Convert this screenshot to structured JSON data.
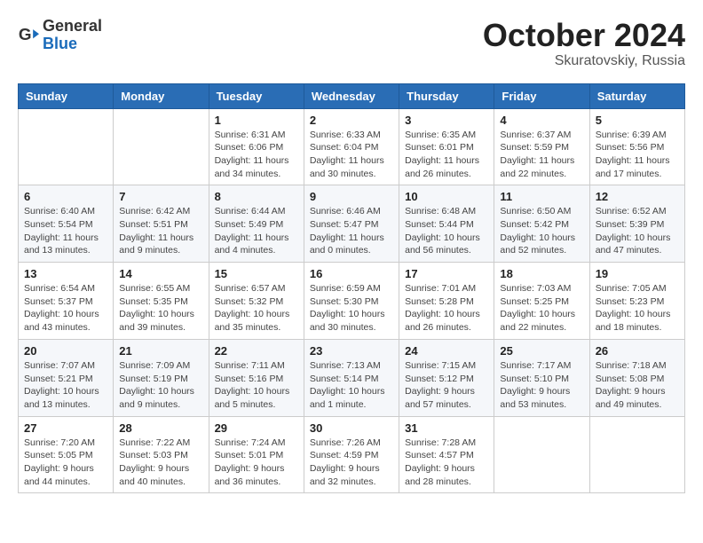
{
  "logo": {
    "text_general": "General",
    "text_blue": "Blue"
  },
  "title": {
    "month": "October 2024",
    "location": "Skuratovskiy, Russia"
  },
  "header_days": [
    "Sunday",
    "Monday",
    "Tuesday",
    "Wednesday",
    "Thursday",
    "Friday",
    "Saturday"
  ],
  "weeks": [
    [
      {
        "day": "",
        "info": ""
      },
      {
        "day": "",
        "info": ""
      },
      {
        "day": "1",
        "info": "Sunrise: 6:31 AM\nSunset: 6:06 PM\nDaylight: 11 hours and 34 minutes."
      },
      {
        "day": "2",
        "info": "Sunrise: 6:33 AM\nSunset: 6:04 PM\nDaylight: 11 hours and 30 minutes."
      },
      {
        "day": "3",
        "info": "Sunrise: 6:35 AM\nSunset: 6:01 PM\nDaylight: 11 hours and 26 minutes."
      },
      {
        "day": "4",
        "info": "Sunrise: 6:37 AM\nSunset: 5:59 PM\nDaylight: 11 hours and 22 minutes."
      },
      {
        "day": "5",
        "info": "Sunrise: 6:39 AM\nSunset: 5:56 PM\nDaylight: 11 hours and 17 minutes."
      }
    ],
    [
      {
        "day": "6",
        "info": "Sunrise: 6:40 AM\nSunset: 5:54 PM\nDaylight: 11 hours and 13 minutes."
      },
      {
        "day": "7",
        "info": "Sunrise: 6:42 AM\nSunset: 5:51 PM\nDaylight: 11 hours and 9 minutes."
      },
      {
        "day": "8",
        "info": "Sunrise: 6:44 AM\nSunset: 5:49 PM\nDaylight: 11 hours and 4 minutes."
      },
      {
        "day": "9",
        "info": "Sunrise: 6:46 AM\nSunset: 5:47 PM\nDaylight: 11 hours and 0 minutes."
      },
      {
        "day": "10",
        "info": "Sunrise: 6:48 AM\nSunset: 5:44 PM\nDaylight: 10 hours and 56 minutes."
      },
      {
        "day": "11",
        "info": "Sunrise: 6:50 AM\nSunset: 5:42 PM\nDaylight: 10 hours and 52 minutes."
      },
      {
        "day": "12",
        "info": "Sunrise: 6:52 AM\nSunset: 5:39 PM\nDaylight: 10 hours and 47 minutes."
      }
    ],
    [
      {
        "day": "13",
        "info": "Sunrise: 6:54 AM\nSunset: 5:37 PM\nDaylight: 10 hours and 43 minutes."
      },
      {
        "day": "14",
        "info": "Sunrise: 6:55 AM\nSunset: 5:35 PM\nDaylight: 10 hours and 39 minutes."
      },
      {
        "day": "15",
        "info": "Sunrise: 6:57 AM\nSunset: 5:32 PM\nDaylight: 10 hours and 35 minutes."
      },
      {
        "day": "16",
        "info": "Sunrise: 6:59 AM\nSunset: 5:30 PM\nDaylight: 10 hours and 30 minutes."
      },
      {
        "day": "17",
        "info": "Sunrise: 7:01 AM\nSunset: 5:28 PM\nDaylight: 10 hours and 26 minutes."
      },
      {
        "day": "18",
        "info": "Sunrise: 7:03 AM\nSunset: 5:25 PM\nDaylight: 10 hours and 22 minutes."
      },
      {
        "day": "19",
        "info": "Sunrise: 7:05 AM\nSunset: 5:23 PM\nDaylight: 10 hours and 18 minutes."
      }
    ],
    [
      {
        "day": "20",
        "info": "Sunrise: 7:07 AM\nSunset: 5:21 PM\nDaylight: 10 hours and 13 minutes."
      },
      {
        "day": "21",
        "info": "Sunrise: 7:09 AM\nSunset: 5:19 PM\nDaylight: 10 hours and 9 minutes."
      },
      {
        "day": "22",
        "info": "Sunrise: 7:11 AM\nSunset: 5:16 PM\nDaylight: 10 hours and 5 minutes."
      },
      {
        "day": "23",
        "info": "Sunrise: 7:13 AM\nSunset: 5:14 PM\nDaylight: 10 hours and 1 minute."
      },
      {
        "day": "24",
        "info": "Sunrise: 7:15 AM\nSunset: 5:12 PM\nDaylight: 9 hours and 57 minutes."
      },
      {
        "day": "25",
        "info": "Sunrise: 7:17 AM\nSunset: 5:10 PM\nDaylight: 9 hours and 53 minutes."
      },
      {
        "day": "26",
        "info": "Sunrise: 7:18 AM\nSunset: 5:08 PM\nDaylight: 9 hours and 49 minutes."
      }
    ],
    [
      {
        "day": "27",
        "info": "Sunrise: 7:20 AM\nSunset: 5:05 PM\nDaylight: 9 hours and 44 minutes."
      },
      {
        "day": "28",
        "info": "Sunrise: 7:22 AM\nSunset: 5:03 PM\nDaylight: 9 hours and 40 minutes."
      },
      {
        "day": "29",
        "info": "Sunrise: 7:24 AM\nSunset: 5:01 PM\nDaylight: 9 hours and 36 minutes."
      },
      {
        "day": "30",
        "info": "Sunrise: 7:26 AM\nSunset: 4:59 PM\nDaylight: 9 hours and 32 minutes."
      },
      {
        "day": "31",
        "info": "Sunrise: 7:28 AM\nSunset: 4:57 PM\nDaylight: 9 hours and 28 minutes."
      },
      {
        "day": "",
        "info": ""
      },
      {
        "day": "",
        "info": ""
      }
    ]
  ]
}
